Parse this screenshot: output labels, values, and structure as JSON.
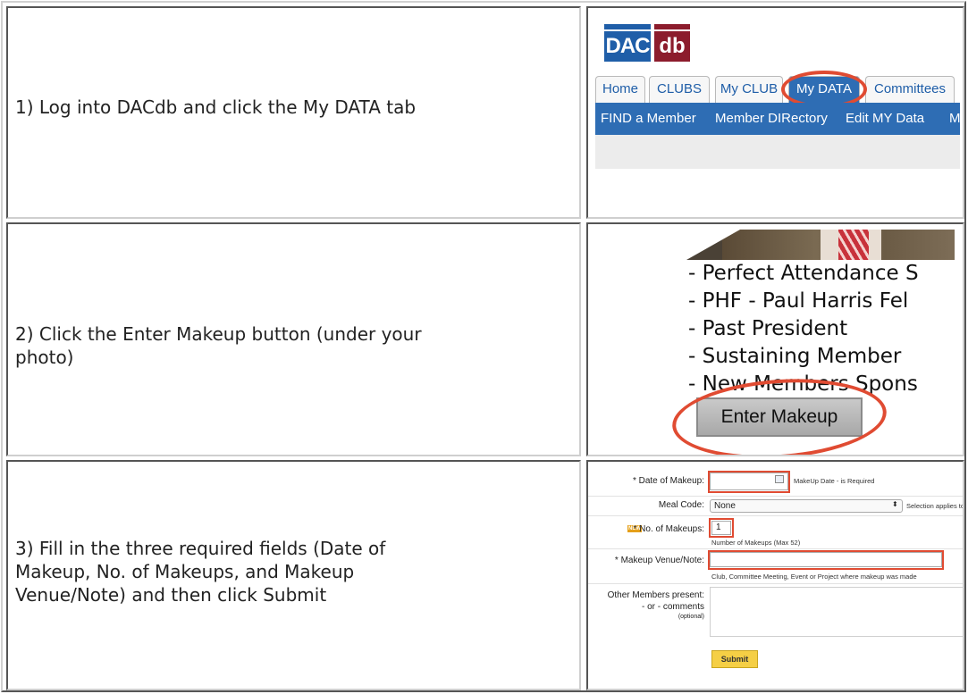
{
  "steps": [
    {
      "text": "1) Log into DACdb and click the My DATA tab"
    },
    {
      "text_line1": "2) Click the Enter Makeup button (under your",
      "text_line2": "photo)"
    },
    {
      "text_line1": "3) Fill in the three required fields (Date of",
      "text_line2": "Makeup, No. of Makeups, and Makeup",
      "text_line3": "Venue/Note) and then click Submit"
    }
  ],
  "dacdb": {
    "logo_left": "DAC",
    "logo_right": "db",
    "tabs": [
      "Home",
      "CLUBS",
      "My CLUB",
      "My DATA",
      "Committees"
    ],
    "active_tab": "My DATA",
    "nav": [
      "FIND a Member",
      "Member DIRectory",
      "Edit MY Data",
      "M"
    ],
    "colors": {
      "blue": "#2e6db4",
      "red": "#8c1c2c",
      "highlight": "#e04b32"
    }
  },
  "profile": {
    "items": [
      "- Perfect Attendance S",
      "- PHF - Paul Harris Fel",
      "- Past President",
      "- Sustaining Member",
      "- New Members Spons"
    ],
    "button_label": "Enter Makeup"
  },
  "form": {
    "date_label": "* Date of Makeup:",
    "date_note": "MakeUp Date - is Required",
    "meal_label": "Meal Code:",
    "meal_value": "None",
    "meal_note": "Selection applies to this",
    "new_badge": "NEW",
    "makeups_label": "* No. of Makeups:",
    "makeups_value": "1",
    "makeups_note": "Number of Makeups (Max 52)",
    "venue_label": "* Makeup Venue/Note:",
    "venue_note": "Club, Committee Meeting, Event or Project where makeup was made",
    "other_label_1": "Other Members present:",
    "other_label_2": "- or - comments",
    "other_label_3": "(optional)",
    "submit_label": "Submit"
  }
}
